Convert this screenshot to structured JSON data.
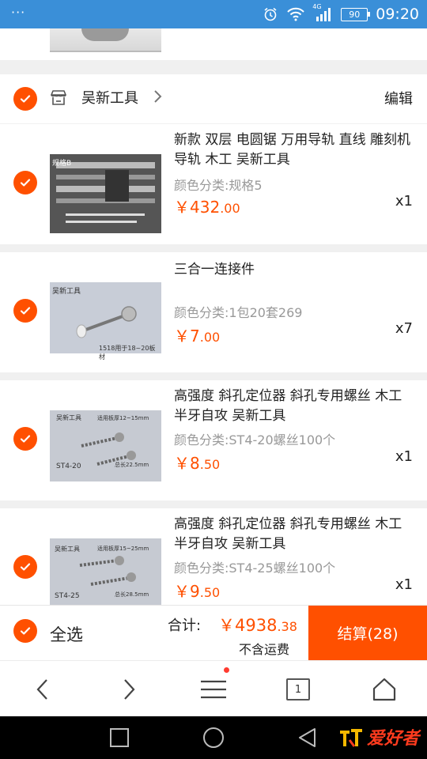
{
  "status_bar": {
    "signal_label": "4G",
    "battery": "90",
    "time": "09:20"
  },
  "shop": {
    "name": "吴新工具",
    "edit_label": "编辑"
  },
  "items": [
    {
      "title": "新款 双层 电圆锯 万用导轨 直线 雕刻机 导轨 木工 吴新工具",
      "variant": "颜色分类:规格5",
      "price_symbol": "￥",
      "price_int": "432",
      "price_dec": ".00",
      "qty": "x1",
      "image_label": "规格B"
    },
    {
      "title": "三合一连接件",
      "variant": "颜色分类:1包20套269",
      "price_symbol": "￥",
      "price_int": "7",
      "price_dec": ".00",
      "qty": "x7",
      "image_label": "吴新工具",
      "image_caption": "1518用于18~20板材"
    },
    {
      "title": "高强度 斜孔定位器 斜孔专用螺丝 木工半牙自攻 吴新工具",
      "variant": "颜色分类:ST4-20螺丝100个",
      "price_symbol": "￥",
      "price_int": "8",
      "price_dec": ".50",
      "qty": "x1",
      "image_label": "吴新工具",
      "image_note": "适用板厚12~15mm",
      "image_code": "ST4-20",
      "image_len": "总长22.5mm"
    },
    {
      "title": "高强度 斜孔定位器 斜孔专用螺丝 木工半牙自攻 吴新工具",
      "variant": "颜色分类:ST4-25螺丝100个",
      "price_symbol": "￥",
      "price_int": "9",
      "price_dec": ".50",
      "qty": "x1",
      "image_label": "吴新工具",
      "image_note": "适用板厚15~25mm",
      "image_code": "ST4-25",
      "image_len": "总长28.5mm"
    }
  ],
  "cart_bar": {
    "select_all": "全选",
    "total_label": "合计:",
    "total_symbol": "￥",
    "total_int": "4938",
    "total_dec": ".38",
    "shipping_note": "不含运费",
    "checkout_label": "结算(28)"
  },
  "browser_nav": {
    "tab_count": "1"
  },
  "watermark": {
    "text": "爱好者"
  },
  "colors": {
    "accent": "#ff5000",
    "status_bar": "#3a8fd8"
  }
}
